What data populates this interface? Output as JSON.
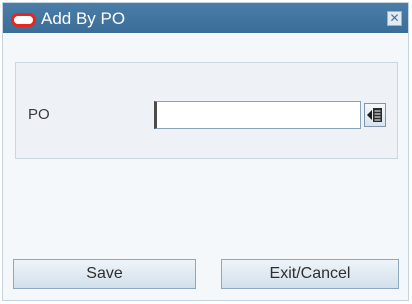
{
  "dialog": {
    "title": "Add By PO",
    "close_icon": "close-icon",
    "logo_icon": "oracle-logo-icon",
    "brand_color": "#e8261f",
    "titlebar_color": "#3f719c"
  },
  "form": {
    "po_label": "PO",
    "po_value": "",
    "lookup_icon": "lookup-list-icon"
  },
  "buttons": {
    "save_label": "Save",
    "exit_label": "Exit/Cancel"
  }
}
